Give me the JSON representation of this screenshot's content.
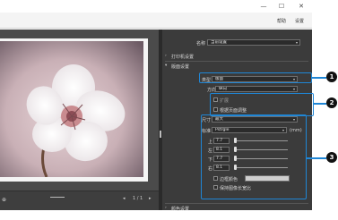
{
  "window": {
    "controls": {
      "minimize": "—",
      "maximize": "☐",
      "close": "✕"
    }
  },
  "menu": {
    "help": "帮助",
    "settings": "设置"
  },
  "panel": {
    "name_label": "名称",
    "name_value": "当前设置",
    "printer_settings": "打印机设置",
    "layout_settings": "版面设置",
    "type_label": "类型",
    "type_value": "版面",
    "orientation_label": "方向",
    "orientation_value": "纵向",
    "expand_label": "扩展",
    "fit_label": "根据页面调整",
    "size_label": "尺寸",
    "size_value": "最大",
    "standard_label": "标准",
    "standard_value": "Pstrgle",
    "unit": "(mm)",
    "margins": [
      {
        "label": "上",
        "value": "7.7"
      },
      {
        "label": "左",
        "value": "8.1"
      },
      {
        "label": "下",
        "value": "7.7"
      },
      {
        "label": "右",
        "value": "8.1"
      }
    ],
    "bg_color_label": "边框颜色",
    "other_option_label": "保持图像长宽比",
    "color_settings": "颜色设置"
  },
  "preview": {
    "page_indicator": "1 / 1"
  },
  "callouts": [
    "1",
    "2",
    "3"
  ],
  "colors": {
    "accent": "#1f86d6",
    "panel_bg": "#3b3b3b",
    "preview_bg": "#4b4b4b"
  }
}
